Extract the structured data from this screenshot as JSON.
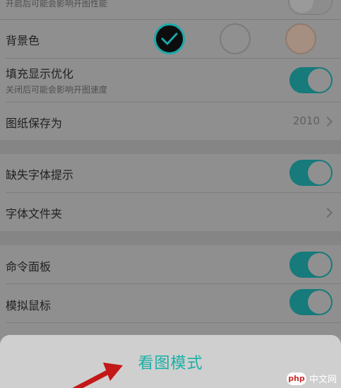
{
  "top_cut": {
    "subtitle": "开启后可能会影响开图性能"
  },
  "background_color": {
    "label": "背景色"
  },
  "fill_display": {
    "label": "填充显示优化",
    "subtitle": "关闭后可能会影响开图速度"
  },
  "save_drawing_as": {
    "label": "图纸保存为",
    "value": "2010"
  },
  "missing_font": {
    "label": "缺失字体提示"
  },
  "font_folder": {
    "label": "字体文件夹"
  },
  "command_panel": {
    "label": "命令面板"
  },
  "mouse_emulation": {
    "label": "模拟鼠标"
  },
  "bottom_sheet": {
    "title": "看图模式"
  },
  "watermark": {
    "badge": "php",
    "text": "中文网"
  },
  "colors": {
    "accent": "#1ab0a6",
    "toggle_on": "#177a7b",
    "swatch_black": "#0d0d0d",
    "swatch_white": "#909090",
    "swatch_beige": "#a58f80",
    "arrow": "#c31818"
  }
}
